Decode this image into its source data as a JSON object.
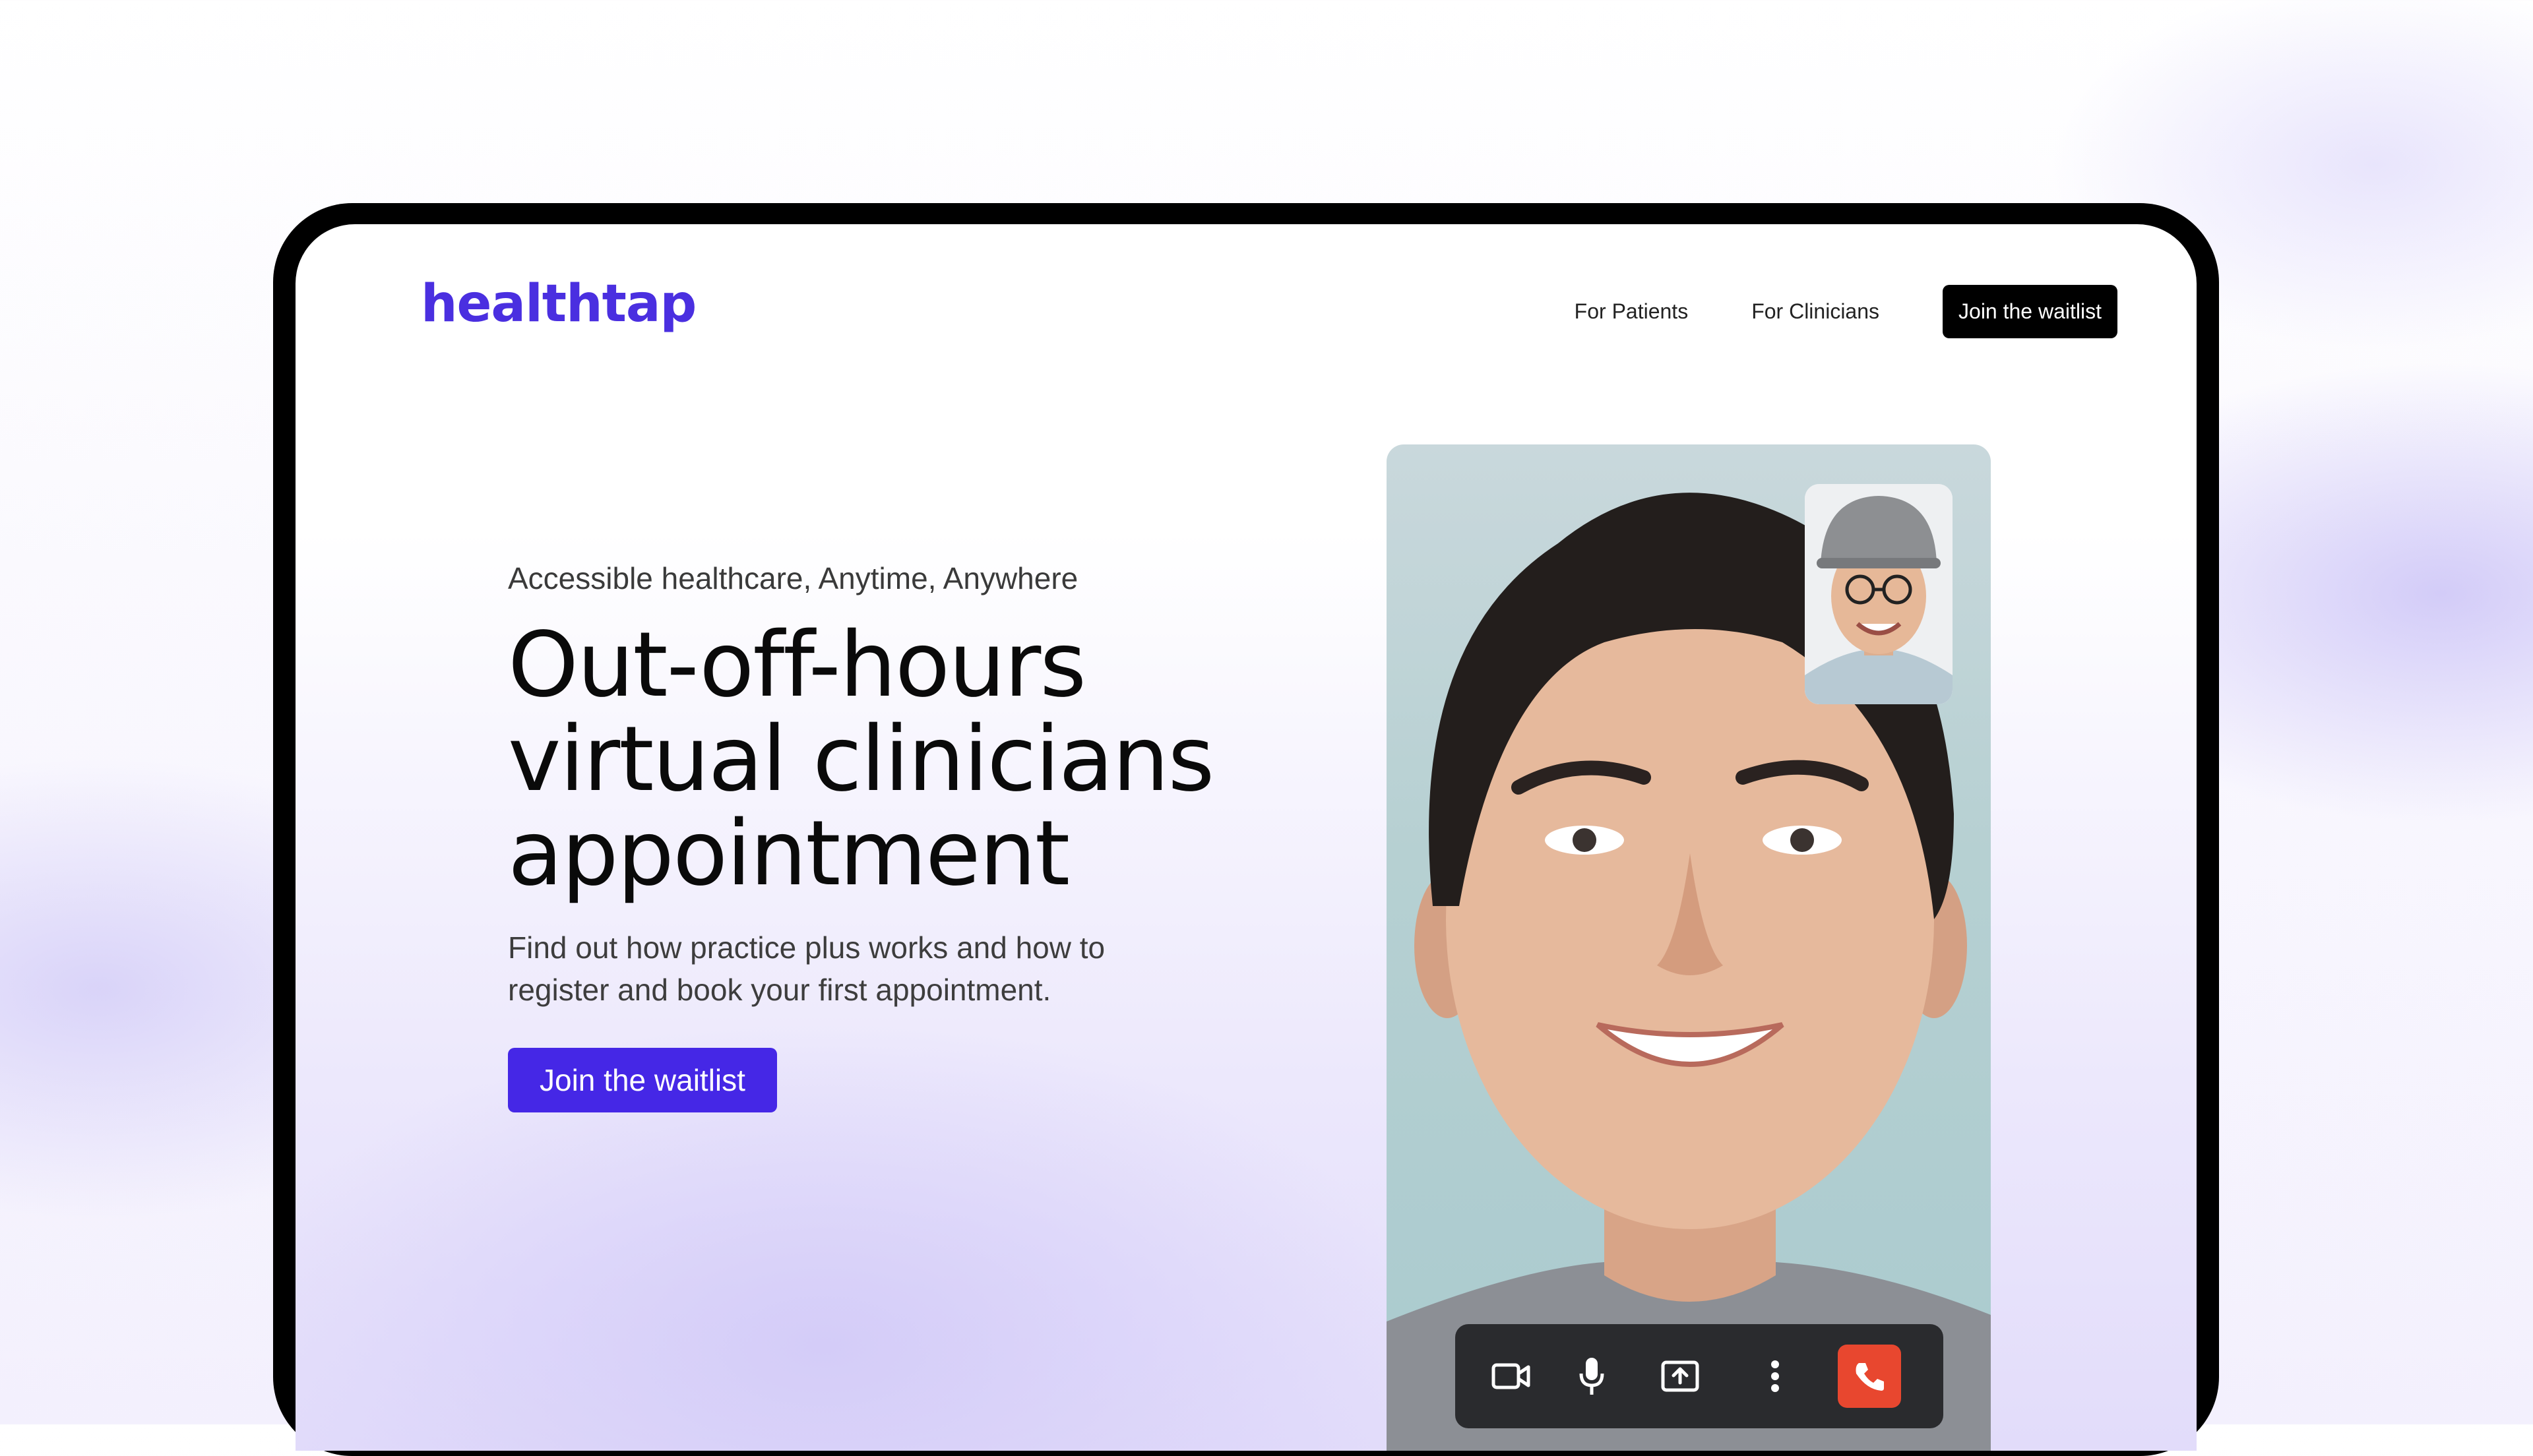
{
  "brand": {
    "logo_text": "healthtap",
    "accent_color": "#4527e6"
  },
  "nav": {
    "links": [
      "For Patients",
      "For Clinicians"
    ],
    "cta_label": "Join the waitlist"
  },
  "hero": {
    "kicker": "Accessible healthcare, Anytime, Anywhere",
    "title_lines": [
      "Out-off-hours",
      "virtual clinicians",
      "appointment"
    ],
    "description": "Find out how practice plus works and how to register and book your first appointment.",
    "cta_label": "Join the waitlist"
  },
  "video_call": {
    "main_participant": "smiling young man",
    "pip_participant": "man in hard hat and glasses",
    "controls": [
      "video-camera-icon",
      "microphone-icon",
      "share-screen-icon",
      "more-options-icon",
      "end-call-icon"
    ],
    "end_call_color": "#e8472f"
  }
}
